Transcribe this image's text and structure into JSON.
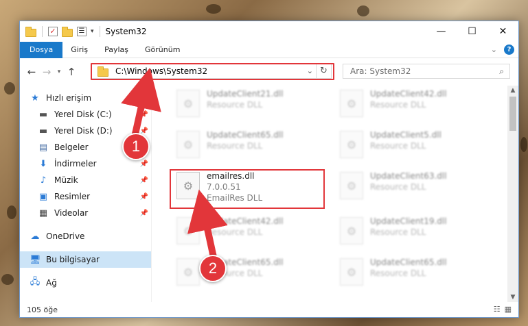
{
  "window": {
    "title": "System32"
  },
  "ribbon": {
    "tabs": [
      "Dosya",
      "Giriş",
      "Paylaş",
      "Görünüm"
    ],
    "active_tab": "Dosya"
  },
  "address": {
    "path": "C:\\Windows\\System32"
  },
  "search": {
    "placeholder": "Ara: System32"
  },
  "nav": {
    "items": [
      {
        "label": "Hızlı erişim",
        "icon": "star-icon",
        "pinned": false
      },
      {
        "label": "Yerel Disk (C:)",
        "icon": "drive-icon",
        "pinned": true
      },
      {
        "label": "Yerel Disk (D:)",
        "icon": "drive-icon",
        "pinned": true
      },
      {
        "label": "Belgeler",
        "icon": "document-icon",
        "pinned": true
      },
      {
        "label": "İndirmeler",
        "icon": "download-icon",
        "pinned": true
      },
      {
        "label": "Müzik",
        "icon": "music-icon",
        "pinned": true
      },
      {
        "label": "Resimler",
        "icon": "picture-icon",
        "pinned": true
      },
      {
        "label": "Videolar",
        "icon": "video-icon",
        "pinned": true
      },
      {
        "label": "OneDrive",
        "icon": "cloud-icon",
        "pinned": false
      },
      {
        "label": "Bu bilgisayar",
        "icon": "computer-icon",
        "pinned": false,
        "selected": true
      },
      {
        "label": "Ağ",
        "icon": "network-icon",
        "pinned": false
      }
    ]
  },
  "files": {
    "left": [
      {
        "name": "UpdateClient21.dll",
        "desc": "Resource DLL"
      },
      {
        "name": "UpdateClient65.dll",
        "desc": "Resource DLL"
      },
      {
        "name": "emailres.dll",
        "version": "7.0.0.51",
        "desc": "EmailRes DLL",
        "highlighted": true
      },
      {
        "name": "UpdateClient42.dll",
        "desc": "Resource DLL"
      },
      {
        "name": "UpdateClient65.dll",
        "desc": "Resource DLL"
      }
    ],
    "right": [
      {
        "name": "UpdateClient42.dll",
        "desc": "Resource DLL"
      },
      {
        "name": "UpdateClient5.dll",
        "desc": "Resource DLL"
      },
      {
        "name": "UpdateClient63.dll",
        "desc": "Resource DLL"
      },
      {
        "name": "UpdateClient19.dll",
        "desc": "Resource DLL"
      },
      {
        "name": "UpdateClient65.dll",
        "desc": "Resource DLL"
      }
    ]
  },
  "status": {
    "count": "105 öğe"
  },
  "annotations": {
    "step1": "1",
    "step2": "2",
    "color": "#e2363a"
  }
}
